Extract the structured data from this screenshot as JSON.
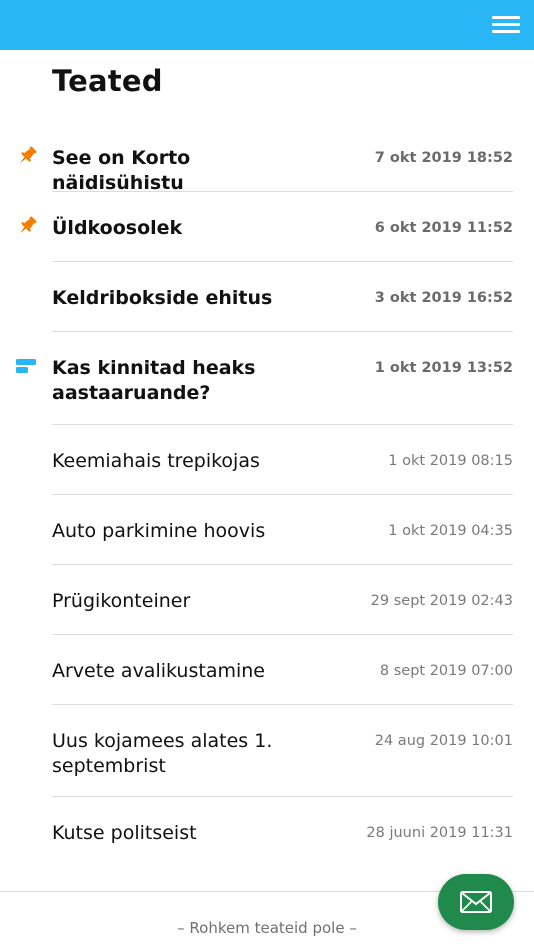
{
  "header": {
    "menu_icon": "hamburger-menu-icon"
  },
  "page": {
    "title": "Teated"
  },
  "notices": [
    {
      "title": "See on Korto näidisühistu",
      "date": "7 okt 2019 18:52",
      "bold": true,
      "icon": "pin-icon"
    },
    {
      "title": "Üldkoosolek",
      "date": "6 okt 2019 11:52",
      "bold": true,
      "icon": "pin-icon"
    },
    {
      "title": "Keldribokside ehitus",
      "date": "3 okt 2019 16:52",
      "bold": true,
      "icon": null
    },
    {
      "title": "Kas kinnitad heaks aastaaruande?",
      "date": "1 okt 2019 13:52",
      "bold": true,
      "icon": "poll-icon"
    },
    {
      "title": "Keemiahais trepikojas",
      "date": "1 okt 2019 08:15",
      "bold": false,
      "icon": null
    },
    {
      "title": "Auto parkimine hoovis",
      "date": "1 okt 2019 04:35",
      "bold": false,
      "icon": null
    },
    {
      "title": "Prügikonteiner",
      "date": "29 sept 2019 02:43",
      "bold": false,
      "icon": null
    },
    {
      "title": "Arvete avalikustamine",
      "date": "8 sept 2019 07:00",
      "bold": false,
      "icon": null
    },
    {
      "title": "Uus kojamees alates 1. septembrist",
      "date": "24 aug 2019 10:01",
      "bold": false,
      "icon": null
    },
    {
      "title": "Kutse politseist",
      "date": "28 juuni 2019 11:31",
      "bold": false,
      "icon": null
    }
  ],
  "footer": {
    "no_more_text": "– Rohkem teateid pole –"
  },
  "fab": {
    "icon": "envelope-icon"
  },
  "colors": {
    "header": "#29b6f6",
    "pin": "#f57c00",
    "poll": "#29b6f6",
    "fab": "#1f8a4c"
  }
}
